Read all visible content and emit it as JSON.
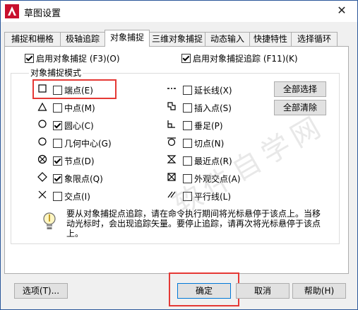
{
  "window": {
    "title": "草图设置",
    "close": "✕"
  },
  "tabs": [
    "捕捉和栅格",
    "极轴追踪",
    "对象捕捉",
    "三维对象捕捉",
    "动态输入",
    "快捷特性",
    "选择循环"
  ],
  "active_tab": 2,
  "toggles": {
    "osnap_on": {
      "label": "启用对象捕捉 (F3)(O)",
      "checked": true
    },
    "otrack_on": {
      "label": "启用对象捕捉追踪 (F11)(K)",
      "checked": true
    }
  },
  "group": {
    "title": "对象捕捉模式"
  },
  "modes_left": [
    {
      "label": "端点(E)",
      "checked": false,
      "icon": "endpoint-square-icon"
    },
    {
      "label": "中点(M)",
      "checked": false,
      "icon": "midpoint-triangle-icon"
    },
    {
      "label": "圆心(C)",
      "checked": true,
      "icon": "center-circle-icon"
    },
    {
      "label": "几何中心(G)",
      "checked": false,
      "icon": "geometric-center-icon"
    },
    {
      "label": "节点(D)",
      "checked": true,
      "icon": "node-icon"
    },
    {
      "label": "象限点(Q)",
      "checked": true,
      "icon": "quadrant-diamond-icon"
    },
    {
      "label": "交点(I)",
      "checked": false,
      "icon": "intersection-x-icon"
    }
  ],
  "modes_right": [
    {
      "label": "延长线(X)",
      "checked": false,
      "icon": "extension-icon"
    },
    {
      "label": "插入点(S)",
      "checked": false,
      "icon": "insertion-icon"
    },
    {
      "label": "垂足(P)",
      "checked": false,
      "icon": "perpendicular-icon"
    },
    {
      "label": "切点(N)",
      "checked": false,
      "icon": "tangent-icon"
    },
    {
      "label": "最近点(R)",
      "checked": false,
      "icon": "nearest-icon"
    },
    {
      "label": "外观交点(A)",
      "checked": false,
      "icon": "apparent-intersection-icon"
    },
    {
      "label": "平行线(L)",
      "checked": false,
      "icon": "parallel-icon"
    }
  ],
  "buttons": {
    "select_all": "全部选择",
    "clear_all": "全部清除",
    "options": "选项(T)...",
    "ok": "确定",
    "cancel": "取消",
    "help": "帮助(H)"
  },
  "hint": "要从对象捕捉点追踪，请在命令执行期间将光标悬停于该点上。当移动光标时，会出现追踪矢量。要停止追踪，请再次将光标悬停于该点上。",
  "colors": {
    "highlight": "#e53935",
    "accent": "#0078d7"
  }
}
